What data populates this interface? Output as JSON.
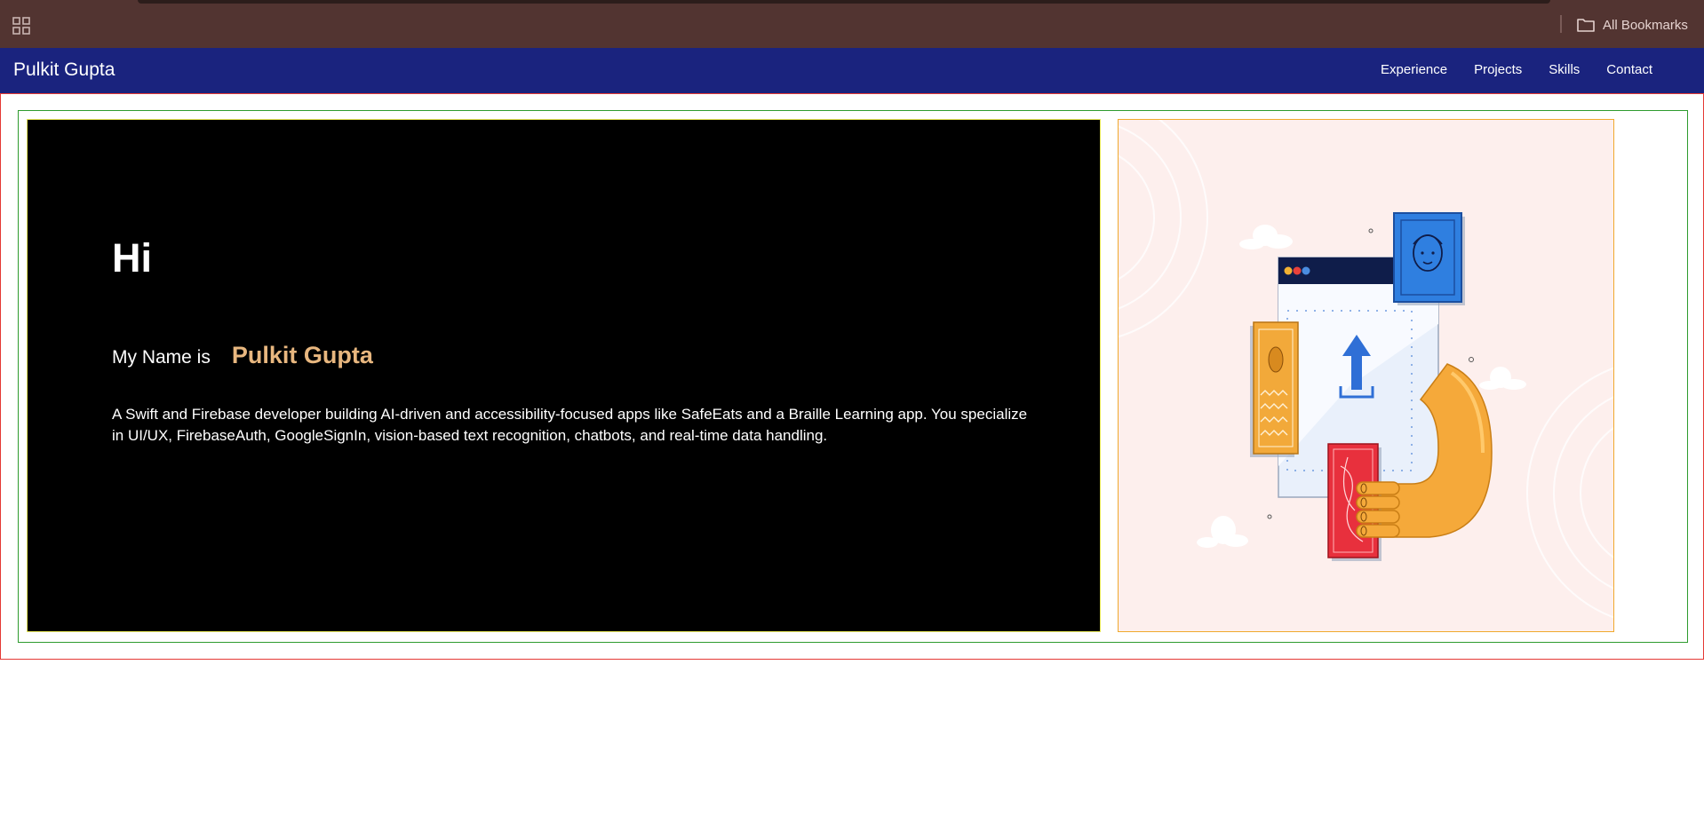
{
  "browser": {
    "bookmarks_bar": {
      "apps_icon": "apps-grid-icon",
      "all_bookmarks_label": "All Bookmarks",
      "all_bookmarks_icon": "folder-icon"
    }
  },
  "nav": {
    "brand": "Pulkit Gupta",
    "links": [
      "Experience",
      "Projects",
      "Skills",
      "Contact"
    ]
  },
  "hero": {
    "greeting": "Hi",
    "name_prefix": "My Name is",
    "name": "Pulkit Gupta",
    "bio": "A Swift and Firebase developer building AI-driven and accessibility-focused apps like SafeEats and a Braille Learning app. You specialize in UI/UX, FirebaseAuth, GoogleSignIn, vision-based text recognition, chatbots, and real-time data handling."
  },
  "illustration": {
    "icon": "developer-upload-illustration"
  },
  "colors": {
    "bookmarks_bar_bg": "#523431",
    "nav_bg": "#1a237e",
    "hero_bg": "#000000",
    "name_accent": "#e8b77f",
    "illustration_bg": "#fdefed",
    "outer_border": "#e53935",
    "inner_border": "#2e9b2e",
    "hero_border": "#e8e85a",
    "illustration_border": "#f0a92e"
  }
}
